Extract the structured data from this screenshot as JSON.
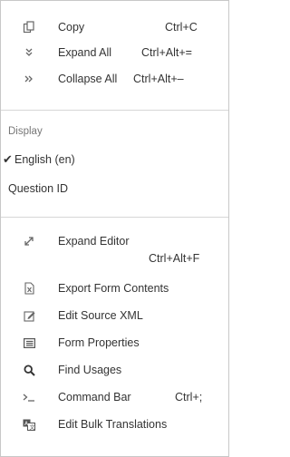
{
  "menu": {
    "clipboard": [
      {
        "label": "Copy",
        "shortcut": "Ctrl+C",
        "icon": "copy-icon"
      },
      {
        "label": "Expand All",
        "shortcut": "Ctrl+Alt+=",
        "icon": "expand-all-icon"
      },
      {
        "label": "Collapse All",
        "shortcut": "Ctrl+Alt+–",
        "icon": "collapse-all-icon"
      }
    ],
    "display": {
      "header": "Display",
      "english": "English (en)",
      "english_checked": true,
      "question_id": "Question ID"
    },
    "tools": [
      {
        "label": "Expand Editor",
        "shortcut": "Ctrl+Alt+F",
        "icon": "expand-editor-icon"
      },
      {
        "label": "Export Form Contents",
        "icon": "export-icon"
      },
      {
        "label": "Edit Source XML",
        "icon": "edit-icon"
      },
      {
        "label": "Form Properties",
        "icon": "form-properties-icon"
      },
      {
        "label": "Find Usages",
        "icon": "search-icon"
      },
      {
        "label": "Command Bar",
        "shortcut": "Ctrl+;",
        "icon": "terminal-icon"
      },
      {
        "label": "Edit Bulk Translations",
        "icon": "translations-icon"
      }
    ]
  }
}
